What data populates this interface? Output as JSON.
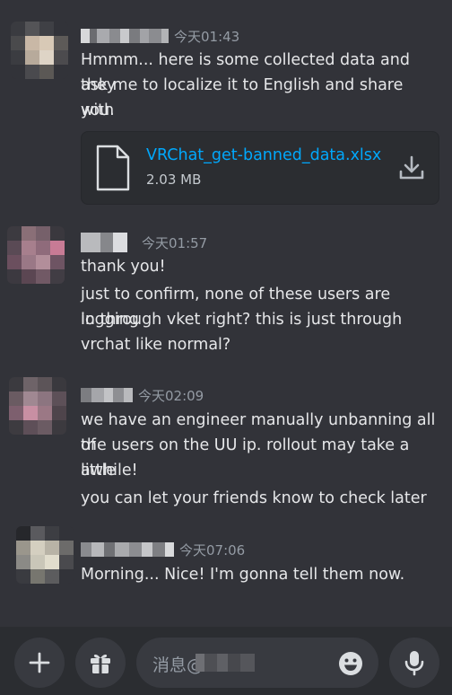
{
  "messages": [
    {
      "timestamp": "今天01:43",
      "lines": [
        "Hmmm... here is some collected data and they",
        "ask me to localize it to English and share with",
        "you."
      ],
      "attachment": {
        "name": "VRChat_get-banned_data.xlsx",
        "size": "2.03 MB"
      }
    },
    {
      "timestamp": "今天01:57",
      "lines": [
        "thank you!",
        "just to confirm, none of these users are logging",
        "in through vket right? this is just through",
        "vrchat like normal?"
      ]
    },
    {
      "timestamp": "今天02:09",
      "lines": [
        "we have an engineer manually unbanning all of",
        "the users on the UU ip. rollout may take a little",
        "awhile!",
        "you can let your friends know to check later"
      ]
    },
    {
      "timestamp": "今天07:06",
      "lines": [
        "Morning... Nice! I'm gonna tell them now."
      ]
    }
  ],
  "composer": {
    "placeholder": "消息@",
    "add_icon": "plus-icon",
    "gift_icon": "gift-icon",
    "emoji_icon": "emoji-icon",
    "mic_icon": "microphone-icon"
  },
  "colors": {
    "background": "#323339",
    "link": "#00a8fc",
    "timestamp": "#949ba4",
    "composer_bg": "#383a40"
  }
}
